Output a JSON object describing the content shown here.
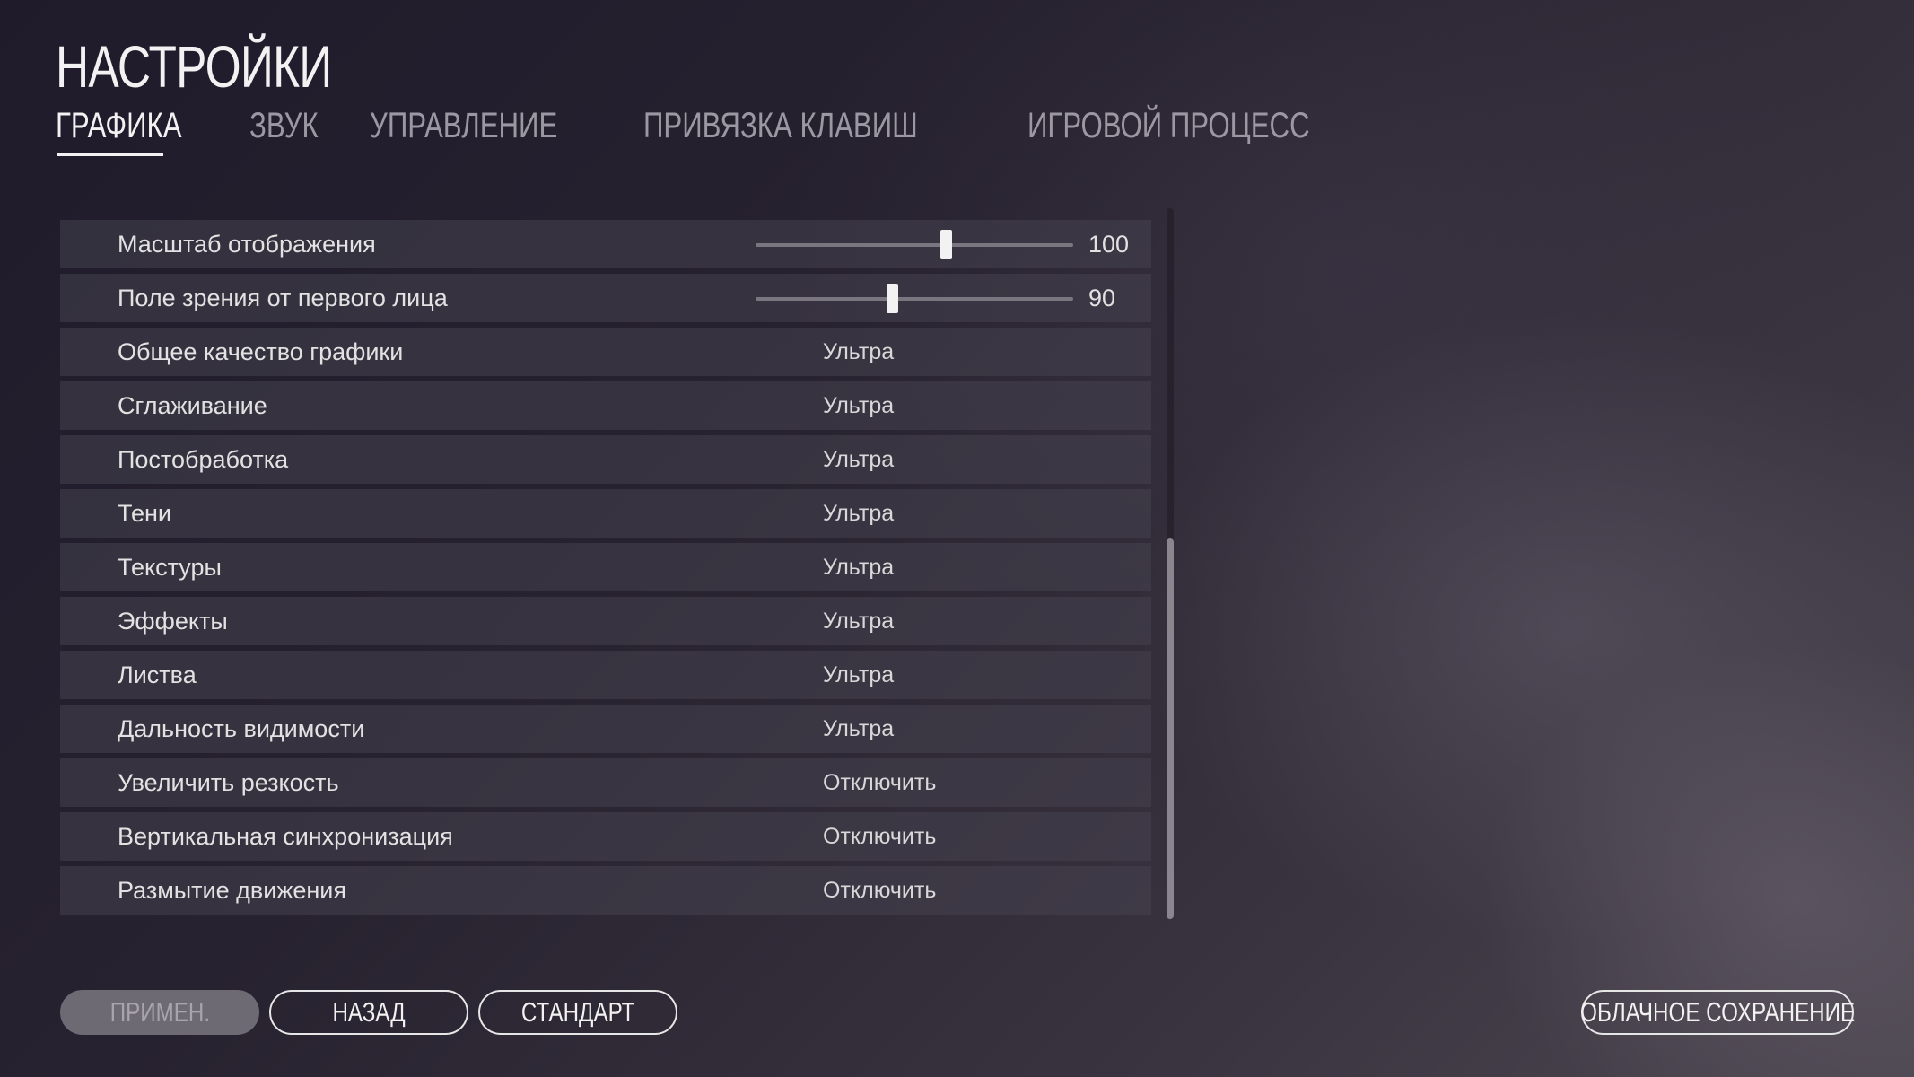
{
  "header": {
    "title": "НАСТРОЙКИ"
  },
  "tabs": [
    {
      "label": "ГРАФИКА",
      "active": true
    },
    {
      "label": "ЗВУК",
      "active": false
    },
    {
      "label": "УПРАВЛЕНИЕ",
      "active": false
    },
    {
      "label": "ПРИВЯЗКА КЛАВИШ",
      "active": false
    },
    {
      "label": "ИГРОВОЙ ПРОЦЕСС",
      "active": false
    }
  ],
  "settings": [
    {
      "label": "Масштаб отображения",
      "type": "slider",
      "value": "100",
      "fraction": 0.6
    },
    {
      "label": "Поле зрения от первого лица",
      "type": "slider",
      "value": "90",
      "fraction": 0.43
    },
    {
      "label": "Общее качество графики",
      "type": "option",
      "value": "Ультра"
    },
    {
      "label": "Сглаживание",
      "type": "option",
      "value": "Ультра"
    },
    {
      "label": "Постобработка",
      "type": "option",
      "value": "Ультра"
    },
    {
      "label": "Тени",
      "type": "option",
      "value": "Ультра"
    },
    {
      "label": "Текстуры",
      "type": "option",
      "value": "Ультра"
    },
    {
      "label": "Эффекты",
      "type": "option",
      "value": "Ультра"
    },
    {
      "label": "Листва",
      "type": "option",
      "value": "Ультра"
    },
    {
      "label": "Дальность видимости",
      "type": "option",
      "value": "Ультра"
    },
    {
      "label": "Увеличить резкость",
      "type": "option",
      "value": "Отключить"
    },
    {
      "label": "Вертикальная синхронизация",
      "type": "option",
      "value": "Отключить"
    },
    {
      "label": "Размытие движения",
      "type": "option",
      "value": "Отключить"
    }
  ],
  "footer": {
    "apply_label": "ПРИМЕН.",
    "back_label": "НАЗАД",
    "default_label": "СТАНДАРТ",
    "cloud_label": "ОБЛАЧНОЕ СОХРАНЕНИЕ"
  },
  "colors": {
    "accent": "#f2f2f2",
    "row_bg": "#46424e",
    "disabled_button": "#6e6a74"
  }
}
